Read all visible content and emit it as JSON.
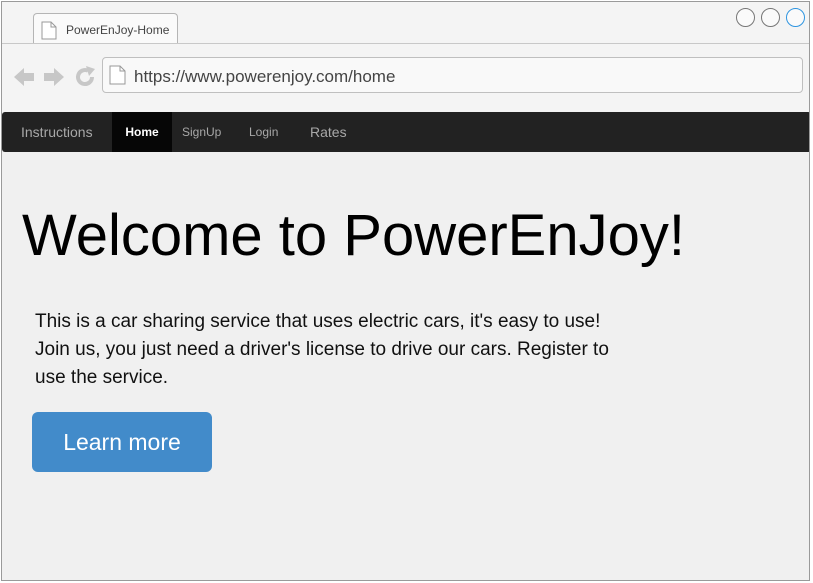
{
  "browser": {
    "tab_title": "PowerEnJoy-Home",
    "url": "https://www.powerenjoy.com/home",
    "window_buttons": [
      "minimize",
      "maximize",
      "close"
    ]
  },
  "navbar": {
    "items": [
      {
        "label": "Instructions",
        "active": false
      },
      {
        "label": "Home",
        "active": true
      },
      {
        "label": "SignUp",
        "active": false
      },
      {
        "label": "Login",
        "active": false
      },
      {
        "label": "Rates",
        "active": false
      }
    ]
  },
  "main": {
    "title": "Welcome to PowerEnJoy!",
    "description": "This is a car sharing service that uses electric cars, it's easy to use! Join us, you just need a driver's license to drive our cars. Register to use the service.",
    "cta_label": "Learn more"
  },
  "colors": {
    "navbar_bg": "#222222",
    "nav_active_bg": "#060606",
    "button_bg": "#428bca",
    "window_active_accent": "#2f95e0"
  }
}
